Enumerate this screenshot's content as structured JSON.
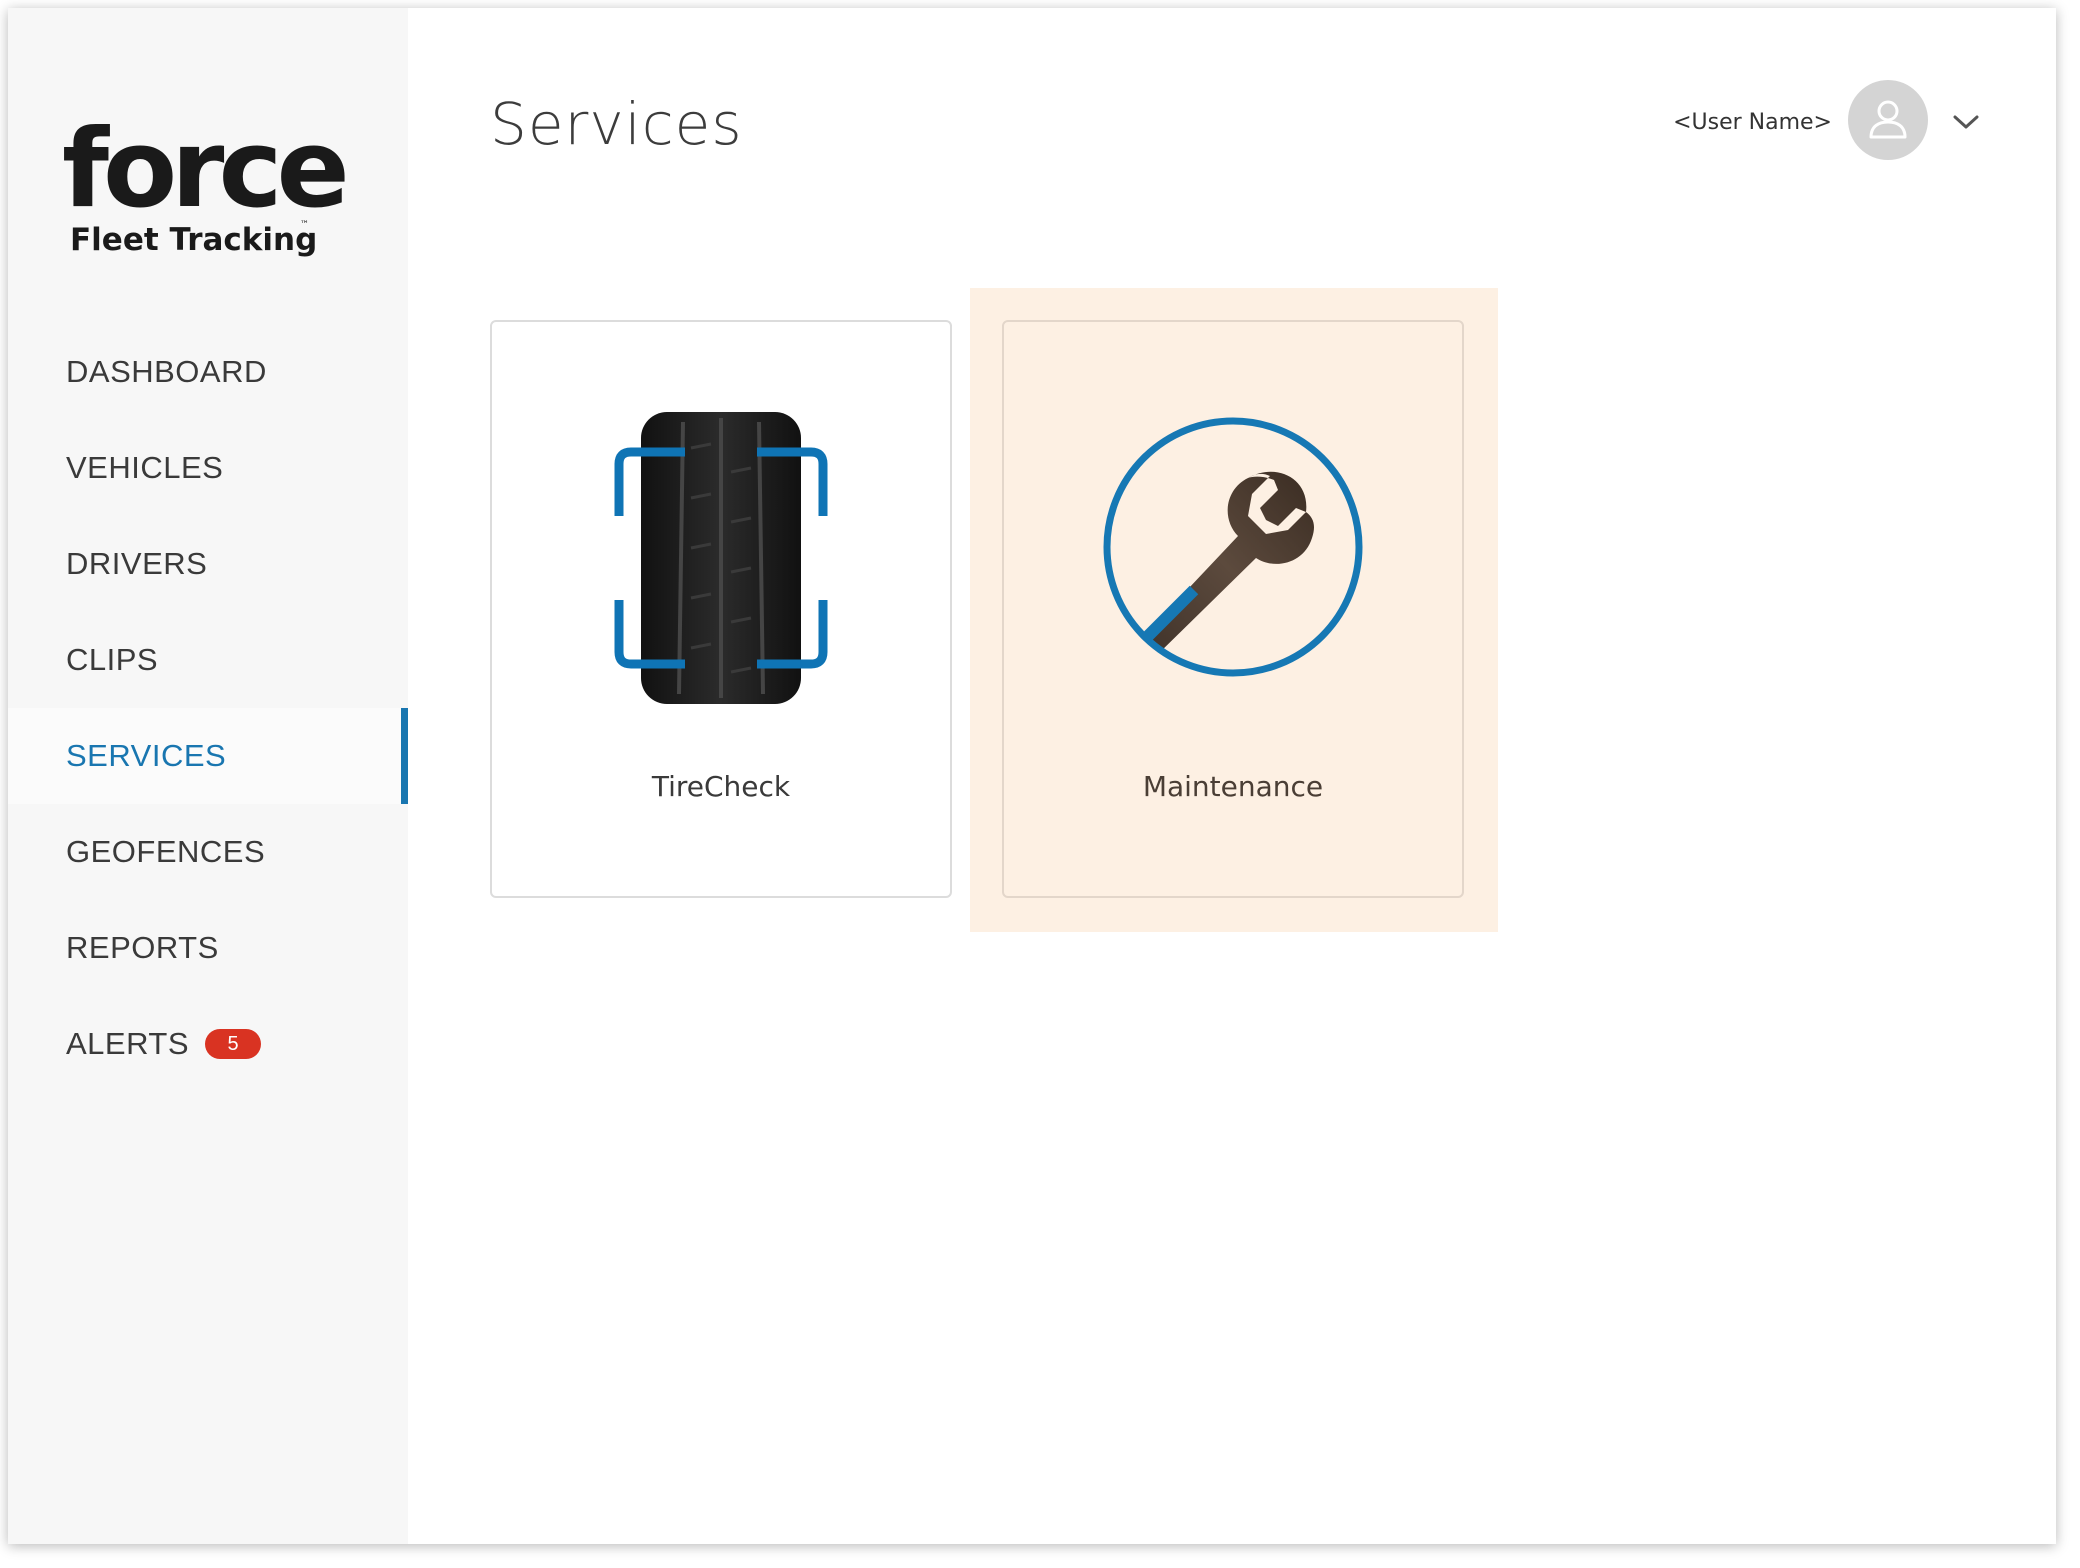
{
  "brand": {
    "logo_word": "force",
    "logo_sub": "Fleet Tracking",
    "logo_tm": "™"
  },
  "header": {
    "title": "Services",
    "user_name": "<User Name>"
  },
  "sidebar": {
    "items": [
      {
        "label": "DASHBOARD"
      },
      {
        "label": "VEHICLES"
      },
      {
        "label": "DRIVERS"
      },
      {
        "label": "CLIPS"
      },
      {
        "label": "SERVICES",
        "active": true
      },
      {
        "label": "GEOFENCES"
      },
      {
        "label": "REPORTS"
      },
      {
        "label": "ALERTS",
        "badge": "5"
      }
    ]
  },
  "services": [
    {
      "label": "TireCheck",
      "icon": "tire-icon"
    },
    {
      "label": "Maintenance",
      "icon": "wrench-icon",
      "highlighted": true
    }
  ],
  "colors": {
    "accent": "#1976b0",
    "badge": "#d93322",
    "sidebar_bg": "#f7f7f7",
    "hover_bg": "#fdf0e3"
  }
}
